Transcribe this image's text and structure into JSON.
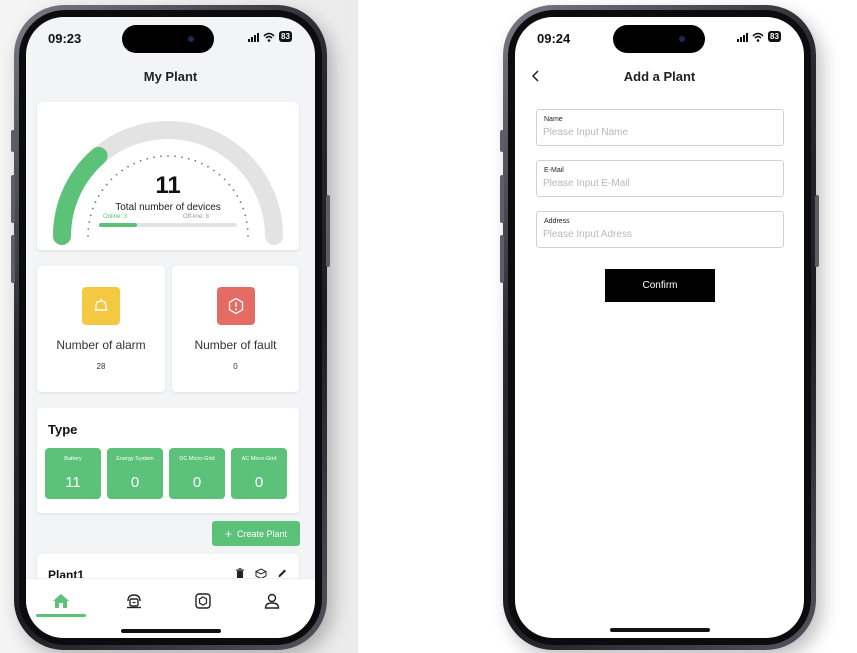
{
  "left_phone": {
    "status": {
      "time": "09:23",
      "battery": "83"
    },
    "title": "My Plant",
    "gauge": {
      "total": "11",
      "total_label": "Total number of devices",
      "online_label": "Online: 3",
      "offline_label": "Off-line: 8",
      "online": 3,
      "offline": 8
    },
    "alarm": {
      "label": "Number of alarm",
      "value": "28",
      "icon": "bell-icon"
    },
    "fault": {
      "label": "Number of fault",
      "value": "0",
      "icon": "alert-icon"
    },
    "type": {
      "title": "Type",
      "tiles": [
        {
          "label": "Battery",
          "value": "11"
        },
        {
          "label": "Energy System",
          "value": "0"
        },
        {
          "label": "DC Micro-Grid",
          "value": "0"
        },
        {
          "label": "AC Micro-Grid",
          "value": "0"
        }
      ]
    },
    "create_button": {
      "icon": "+",
      "label": "Create Plant"
    },
    "plant": {
      "name": "Plant1"
    },
    "tabs": [
      "home-icon",
      "device-icon",
      "plant-icon",
      "profile-icon"
    ],
    "active_tab": 0
  },
  "right_phone": {
    "status": {
      "time": "09:24",
      "battery": "83"
    },
    "title": "Add a Plant",
    "fields": [
      {
        "label": "Name",
        "placeholder": "Please Input Name"
      },
      {
        "label": "E-Mail",
        "placeholder": "Please Input E-Mail"
      },
      {
        "label": "Address",
        "placeholder": "Please Input Adress"
      }
    ],
    "confirm_label": "Confirm"
  },
  "colors": {
    "accent": "#5cc27a",
    "alarm": "#f5c842",
    "fault": "#e46c64",
    "track": "#e3e3e3"
  }
}
